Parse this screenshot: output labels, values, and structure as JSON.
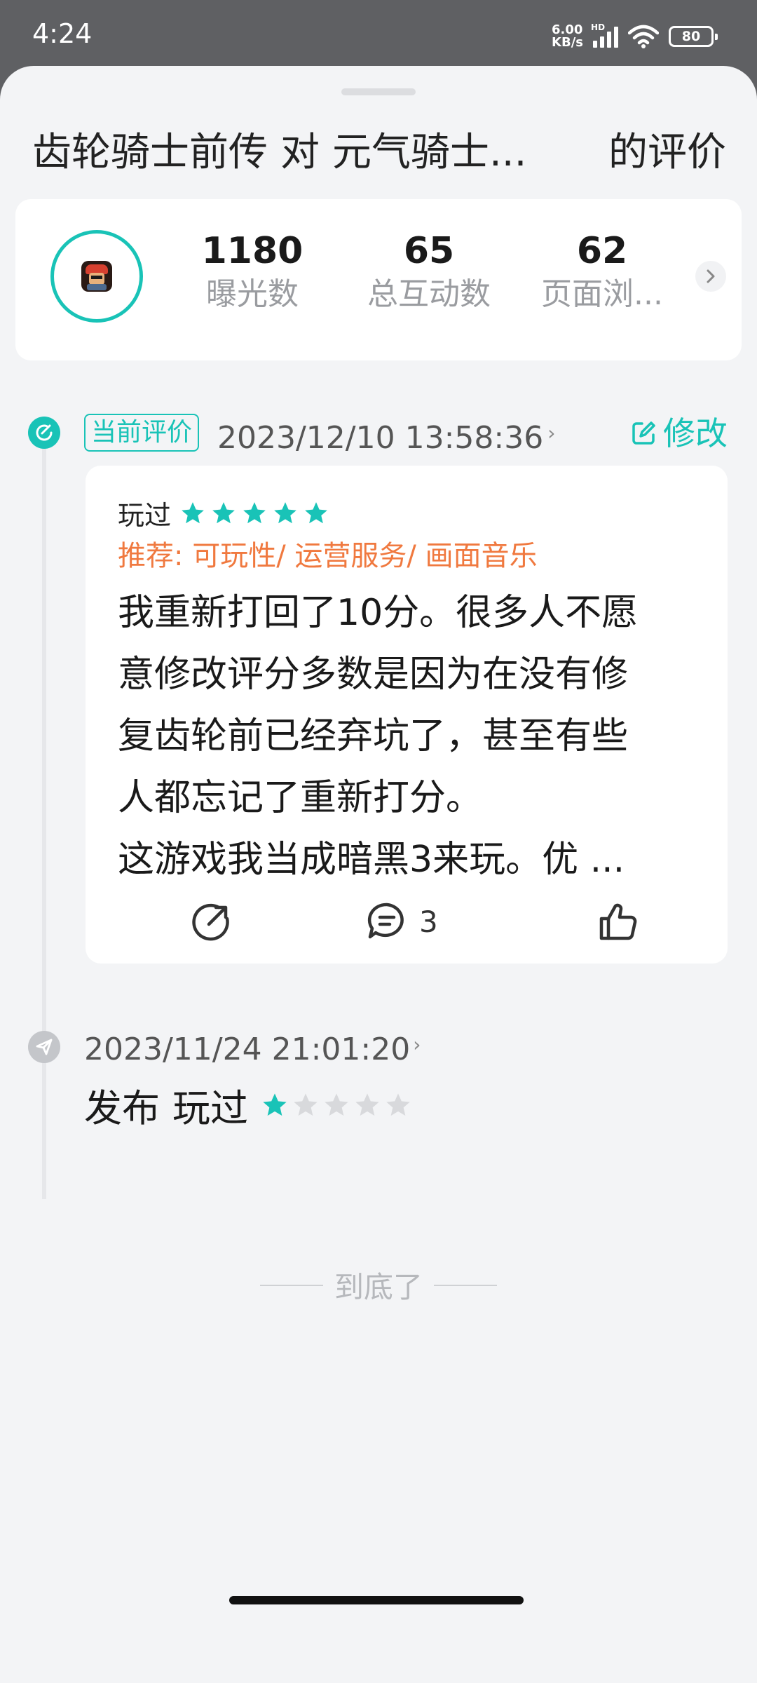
{
  "status_bar": {
    "time": "4:24",
    "net_speed_value": "6.00",
    "net_speed_unit": "KB/s",
    "hd_label": "HD",
    "battery": "80"
  },
  "header": {
    "game_name": "齿轮骑士前传",
    "connector": "对",
    "target_name": "元气骑士...",
    "suffix": "的评价"
  },
  "stats": [
    {
      "value": "1180",
      "label": "曝光数"
    },
    {
      "value": "65",
      "label": "总互动数"
    },
    {
      "value": "62",
      "label": "页面浏..."
    }
  ],
  "current_review": {
    "tag": "当前评价",
    "time": "2023/12/10 13:58:36",
    "edit_label": "修改",
    "status": "玩过",
    "rating": 5,
    "tags": "推荐: 可玩性/ 运营服务/ 画面音乐",
    "content_lines": [
      "我重新打回了10分。很多人不愿",
      "意修改评分多数是因为在没有修",
      "复齿轮前已经弃坑了，甚至有些",
      "人都忘记了重新打分。",
      "这游戏我当成暗黑3来玩。优 ..."
    ],
    "comment_count": "3"
  },
  "earlier_review": {
    "time": "2023/11/24 21:01:20",
    "action": "发布",
    "status": "玩过",
    "rating": 1
  },
  "end_text": "到底了",
  "colors": {
    "accent": "#19c3b7",
    "tag_orange": "#f0793f",
    "star_off": "#d8d9dc"
  }
}
